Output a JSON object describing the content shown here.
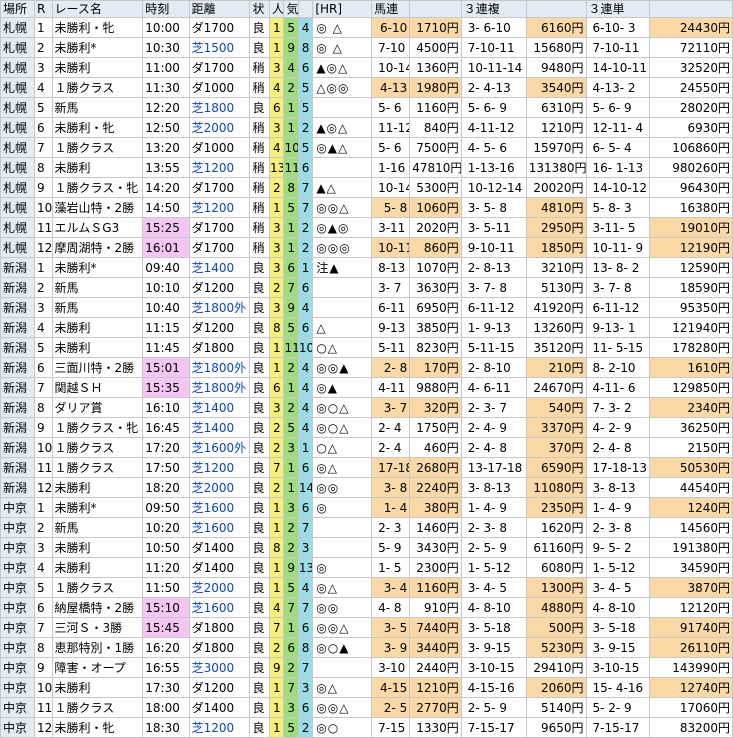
{
  "columns": [
    "場所",
    "R",
    "レース名",
    "時刻",
    "距離",
    "状",
    "人",
    "気",
    "",
    "[HR]",
    "馬連",
    "",
    "３連複",
    "",
    "３連単",
    ""
  ],
  "races": [
    {
      "venue": "札幌",
      "r": "1",
      "name": "未勝利・牝",
      "time": "10:00",
      "dist": "ダ1700",
      "cond": "良",
      "p": [
        "1",
        "5",
        "4"
      ],
      "hr": "◎  △",
      "uma_c": "6-10",
      "uma_p": "1710円",
      "fuku_c": "3- 6-10",
      "fuku_p": "6160円",
      "tan_c": "6-10- 3",
      "tan_p": "24430円",
      "hit": [
        1,
        1,
        1
      ],
      "time_hl": false
    },
    {
      "venue": "札幌",
      "r": "2",
      "name": "未勝利*",
      "time": "10:30",
      "dist": "芝1500",
      "cond": "良",
      "p": [
        "1",
        "9",
        "8"
      ],
      "hr": "◎  △",
      "uma_c": "7-10",
      "uma_p": "4500円",
      "fuku_c": "7-10-11",
      "fuku_p": "15680円",
      "tan_c": "7-10-11",
      "tan_p": "72110円",
      "hit": [
        0,
        0,
        0
      ],
      "time_hl": false
    },
    {
      "venue": "札幌",
      "r": "3",
      "name": "未勝利",
      "time": "11:00",
      "dist": "ダ1700",
      "cond": "稍",
      "p": [
        "3",
        "4",
        "6"
      ],
      "hr": "▲◎△",
      "uma_c": "10-14",
      "uma_p": "1360円",
      "fuku_c": "10-11-14",
      "fuku_p": "9480円",
      "tan_c": "14-10-11",
      "tan_p": "32520円",
      "hit": [
        0,
        0,
        0
      ],
      "time_hl": false
    },
    {
      "venue": "札幌",
      "r": "4",
      "name": "１勝クラス",
      "time": "11:30",
      "dist": "ダ1000",
      "cond": "稍",
      "p": [
        "4",
        "2",
        "5"
      ],
      "hr": "△◎◎",
      "uma_c": "4-13",
      "uma_p": "1980円",
      "fuku_c": "2- 4-13",
      "fuku_p": "3540円",
      "tan_c": "4-13- 2",
      "tan_p": "24550円",
      "hit": [
        1,
        1,
        0
      ],
      "time_hl": false
    },
    {
      "venue": "札幌",
      "r": "5",
      "name": "新馬",
      "time": "12:20",
      "dist": "芝1800",
      "cond": "良",
      "p": [
        "6",
        "1",
        "5"
      ],
      "hr": "",
      "uma_c": "5- 6",
      "uma_p": "1160円",
      "fuku_c": "5- 6- 9",
      "fuku_p": "6310円",
      "tan_c": "5- 6- 9",
      "tan_p": "28020円",
      "hit": [
        0,
        0,
        0
      ],
      "time_hl": false
    },
    {
      "venue": "札幌",
      "r": "6",
      "name": "未勝利・牝",
      "time": "12:50",
      "dist": "芝2000",
      "cond": "稍",
      "p": [
        "3",
        "1",
        "2"
      ],
      "hr": "▲◎△",
      "uma_c": "11-12",
      "uma_p": "840円",
      "fuku_c": "4-11-12",
      "fuku_p": "1210円",
      "tan_c": "12-11- 4",
      "tan_p": "6930円",
      "hit": [
        0,
        0,
        0
      ],
      "time_hl": false
    },
    {
      "venue": "札幌",
      "r": "7",
      "name": "１勝クラス",
      "time": "13:20",
      "dist": "ダ1000",
      "cond": "稍",
      "p": [
        "4",
        "10",
        "5"
      ],
      "hr": "◎▲△",
      "uma_c": "5- 6",
      "uma_p": "7500円",
      "fuku_c": "4- 5- 6",
      "fuku_p": "15970円",
      "tan_c": "6- 5- 4",
      "tan_p": "106860円",
      "hit": [
        0,
        0,
        0
      ],
      "time_hl": false
    },
    {
      "venue": "札幌",
      "r": "8",
      "name": "未勝利",
      "time": "13:55",
      "dist": "芝1200",
      "cond": "稍",
      "p": [
        "13",
        "11",
        "6"
      ],
      "hr": "",
      "uma_c": "1-16",
      "uma_p": "47810円",
      "fuku_c": "1-13-16",
      "fuku_p": "131380円",
      "tan_c": "16- 1-13",
      "tan_p": "980260円",
      "hit": [
        0,
        0,
        0
      ],
      "time_hl": false
    },
    {
      "venue": "札幌",
      "r": "9",
      "name": "１勝クラス・牝",
      "time": "14:20",
      "dist": "ダ1700",
      "cond": "稍",
      "p": [
        "2",
        "8",
        "7"
      ],
      "hr": "▲△",
      "uma_c": "10-14",
      "uma_p": "5300円",
      "fuku_c": "10-12-14",
      "fuku_p": "20020円",
      "tan_c": "14-10-12",
      "tan_p": "96430円",
      "hit": [
        0,
        0,
        0
      ],
      "time_hl": false
    },
    {
      "venue": "札幌",
      "r": "10",
      "name": "藻岩山特・2勝",
      "time": "14:50",
      "dist": "芝1200",
      "cond": "稍",
      "p": [
        "1",
        "5",
        "7"
      ],
      "hr": "◎◎△",
      "uma_c": "5- 8",
      "uma_p": "1060円",
      "fuku_c": "3- 5- 8",
      "fuku_p": "4810円",
      "tan_c": "5- 8- 3",
      "tan_p": "16380円",
      "hit": [
        1,
        1,
        0
      ],
      "time_hl": false
    },
    {
      "venue": "札幌",
      "r": "11",
      "name": "エルムＳG3",
      "time": "15:25",
      "dist": "ダ1700",
      "cond": "稍",
      "p": [
        "3",
        "1",
        "2"
      ],
      "hr": "◎▲◎",
      "uma_c": "3-11",
      "uma_p": "2020円",
      "fuku_c": "3- 5-11",
      "fuku_p": "2950円",
      "tan_c": "3-11- 5",
      "tan_p": "19010円",
      "hit": [
        0,
        1,
        1
      ],
      "time_hl": true
    },
    {
      "venue": "札幌",
      "r": "12",
      "name": "摩周湖特・2勝",
      "time": "16:01",
      "dist": "ダ1700",
      "cond": "稍",
      "p": [
        "3",
        "1",
        "2"
      ],
      "hr": "◎◎◎",
      "uma_c": "10-11",
      "uma_p": "860円",
      "fuku_c": "9-10-11",
      "fuku_p": "1850円",
      "tan_c": "10-11- 9",
      "tan_p": "12190円",
      "hit": [
        1,
        1,
        1
      ],
      "time_hl": true
    },
    {
      "venue": "新潟",
      "r": "1",
      "name": "未勝利*",
      "time": "09:40",
      "dist": "芝1400",
      "cond": "良",
      "p": [
        "3",
        "6",
        "1"
      ],
      "hr": "注▲",
      "uma_c": "8-13",
      "uma_p": "1070円",
      "fuku_c": "2- 8-13",
      "fuku_p": "3210円",
      "tan_c": "13- 8- 2",
      "tan_p": "12590円",
      "hit": [
        0,
        0,
        0
      ],
      "time_hl": false
    },
    {
      "venue": "新潟",
      "r": "2",
      "name": "新馬",
      "time": "10:10",
      "dist": "ダ1200",
      "cond": "良",
      "p": [
        "2",
        "7",
        "6"
      ],
      "hr": "",
      "uma_c": "3- 7",
      "uma_p": "3630円",
      "fuku_c": "3- 7- 8",
      "fuku_p": "5130円",
      "tan_c": "3- 7- 8",
      "tan_p": "18590円",
      "hit": [
        0,
        0,
        0
      ],
      "time_hl": false
    },
    {
      "venue": "新潟",
      "r": "3",
      "name": "新馬",
      "time": "10:40",
      "dist": "芝1800外",
      "cond": "良",
      "p": [
        "3",
        "9",
        "4"
      ],
      "hr": "",
      "uma_c": "6-11",
      "uma_p": "6950円",
      "fuku_c": "6-11-12",
      "fuku_p": "41920円",
      "tan_c": "6-11-12",
      "tan_p": "95350円",
      "hit": [
        0,
        0,
        0
      ],
      "time_hl": false
    },
    {
      "venue": "新潟",
      "r": "4",
      "name": "未勝利",
      "time": "11:15",
      "dist": "ダ1200",
      "cond": "良",
      "p": [
        "8",
        "5",
        "6"
      ],
      "hr": "△",
      "uma_c": "9-13",
      "uma_p": "3850円",
      "fuku_c": "1- 9-13",
      "fuku_p": "13260円",
      "tan_c": "9-13- 1",
      "tan_p": "121940円",
      "hit": [
        0,
        0,
        0
      ],
      "time_hl": false
    },
    {
      "venue": "新潟",
      "r": "5",
      "name": "未勝利",
      "time": "11:45",
      "dist": "ダ1800",
      "cond": "良",
      "p": [
        "1",
        "11",
        "10"
      ],
      "hr": "○△",
      "uma_c": "5-11",
      "uma_p": "8230円",
      "fuku_c": "5-11-15",
      "fuku_p": "35120円",
      "tan_c": "11- 5-15",
      "tan_p": "178280円",
      "hit": [
        0,
        0,
        0
      ],
      "time_hl": false
    },
    {
      "venue": "新潟",
      "r": "6",
      "name": "三面川特・2勝",
      "time": "15:01",
      "dist": "芝1800外",
      "cond": "良",
      "p": [
        "1",
        "2",
        "4"
      ],
      "hr": "◎◎▲",
      "uma_c": "2- 8",
      "uma_p": "170円",
      "fuku_c": "2- 8-10",
      "fuku_p": "210円",
      "tan_c": "8- 2-10",
      "tan_p": "1610円",
      "hit": [
        1,
        1,
        1
      ],
      "time_hl": true
    },
    {
      "venue": "新潟",
      "r": "7",
      "name": "関越ＳＨ",
      "time": "15:35",
      "dist": "芝1800外",
      "cond": "良",
      "p": [
        "6",
        "1",
        "4"
      ],
      "hr": "◎▲",
      "uma_c": "4-11",
      "uma_p": "9880円",
      "fuku_c": "4- 6-11",
      "fuku_p": "24670円",
      "tan_c": "4-11- 6",
      "tan_p": "129850円",
      "hit": [
        0,
        0,
        0
      ],
      "time_hl": true
    },
    {
      "venue": "新潟",
      "r": "8",
      "name": "ダリア賞",
      "time": "16:10",
      "dist": "芝1400",
      "cond": "良",
      "p": [
        "3",
        "2",
        "4"
      ],
      "hr": "◎○△",
      "uma_c": "3- 7",
      "uma_p": "320円",
      "fuku_c": "2- 3- 7",
      "fuku_p": "540円",
      "tan_c": "7- 3- 2",
      "tan_p": "2340円",
      "hit": [
        1,
        1,
        1
      ],
      "time_hl": false
    },
    {
      "venue": "新潟",
      "r": "9",
      "name": "１勝クラス・牝",
      "time": "16:45",
      "dist": "芝1400",
      "cond": "良",
      "p": [
        "2",
        "5",
        "4"
      ],
      "hr": "◎○△",
      "uma_c": "2- 4",
      "uma_p": "1750円",
      "fuku_c": "2- 4- 9",
      "fuku_p": "3370円",
      "tan_c": "4- 2- 9",
      "tan_p": "36250円",
      "hit": [
        0,
        1,
        0
      ],
      "time_hl": false
    },
    {
      "venue": "新潟",
      "r": "10",
      "name": "１勝クラス",
      "time": "17:20",
      "dist": "芝1600外",
      "cond": "良",
      "p": [
        "2",
        "3",
        "1"
      ],
      "hr": "○△",
      "uma_c": "2- 4",
      "uma_p": "460円",
      "fuku_c": "2- 4- 8",
      "fuku_p": "370円",
      "tan_c": "2- 4- 8",
      "tan_p": "2150円",
      "hit": [
        0,
        1,
        0
      ],
      "time_hl": false
    },
    {
      "venue": "新潟",
      "r": "11",
      "name": "１勝クラス",
      "time": "17:50",
      "dist": "芝1200",
      "cond": "良",
      "p": [
        "7",
        "1",
        "6"
      ],
      "hr": "◎△",
      "uma_c": "17-18",
      "uma_p": "2680円",
      "fuku_c": "13-17-18",
      "fuku_p": "6590円",
      "tan_c": "17-18-13",
      "tan_p": "50530円",
      "hit": [
        1,
        1,
        1
      ],
      "time_hl": false
    },
    {
      "venue": "新潟",
      "r": "12",
      "name": "未勝利",
      "time": "18:20",
      "dist": "芝2000",
      "cond": "良",
      "p": [
        "2",
        "1",
        "14"
      ],
      "hr": "◎◎",
      "uma_c": "3- 8",
      "uma_p": "2240円",
      "fuku_c": "3- 8-13",
      "fuku_p": "11080円",
      "tan_c": "3- 8-13",
      "tan_p": "44540円",
      "hit": [
        1,
        1,
        0
      ],
      "time_hl": false
    },
    {
      "venue": "中京",
      "r": "1",
      "name": "未勝利*",
      "time": "09:50",
      "dist": "芝1600",
      "cond": "良",
      "p": [
        "1",
        "3",
        "6"
      ],
      "hr": "◎",
      "uma_c": "1- 4",
      "uma_p": "380円",
      "fuku_c": "1- 4- 9",
      "fuku_p": "2350円",
      "tan_c": "1- 4- 9",
      "tan_p": "1240円",
      "hit": [
        1,
        1,
        1
      ],
      "time_hl": false
    },
    {
      "venue": "中京",
      "r": "2",
      "name": "新馬",
      "time": "10:20",
      "dist": "芝1600",
      "cond": "良",
      "p": [
        "1",
        "2",
        "7"
      ],
      "hr": "",
      "uma_c": "2- 3",
      "uma_p": "1460円",
      "fuku_c": "2- 3- 8",
      "fuku_p": "1620円",
      "tan_c": "2- 3- 8",
      "tan_p": "14560円",
      "hit": [
        0,
        0,
        0
      ],
      "time_hl": false
    },
    {
      "venue": "中京",
      "r": "3",
      "name": "未勝利",
      "time": "10:50",
      "dist": "ダ1400",
      "cond": "良",
      "p": [
        "8",
        "2",
        "3"
      ],
      "hr": "",
      "uma_c": "5- 9",
      "uma_p": "3430円",
      "fuku_c": "2- 5- 9",
      "fuku_p": "61160円",
      "tan_c": "9- 5- 2",
      "tan_p": "191380円",
      "hit": [
        0,
        0,
        0
      ],
      "time_hl": false
    },
    {
      "venue": "中京",
      "r": "4",
      "name": "未勝利",
      "time": "11:20",
      "dist": "ダ1400",
      "cond": "良",
      "p": [
        "1",
        "9",
        "13"
      ],
      "hr": "◎",
      "uma_c": "1- 5",
      "uma_p": "2300円",
      "fuku_c": "1- 5-12",
      "fuku_p": "6080円",
      "tan_c": "1- 5-12",
      "tan_p": "34590円",
      "hit": [
        0,
        0,
        0
      ],
      "time_hl": false
    },
    {
      "venue": "中京",
      "r": "5",
      "name": "１勝クラス",
      "time": "11:50",
      "dist": "芝2000",
      "cond": "良",
      "p": [
        "1",
        "5",
        "4"
      ],
      "hr": "◎△",
      "uma_c": "3- 4",
      "uma_p": "1160円",
      "fuku_c": "3- 4- 5",
      "fuku_p": "1300円",
      "tan_c": "3- 4- 5",
      "tan_p": "3870円",
      "hit": [
        1,
        1,
        1
      ],
      "time_hl": false
    },
    {
      "venue": "中京",
      "r": "6",
      "name": "納屋橋特・2勝",
      "time": "15:10",
      "dist": "芝1600",
      "cond": "良",
      "p": [
        "4",
        "7",
        "7"
      ],
      "hr": "◎◎",
      "uma_c": "4- 8",
      "uma_p": "910円",
      "fuku_c": "4- 8-10",
      "fuku_p": "4880円",
      "tan_c": "4- 8-10",
      "tan_p": "12120円",
      "hit": [
        0,
        1,
        0
      ],
      "time_hl": true
    },
    {
      "venue": "中京",
      "r": "7",
      "name": "三河Ｓ・3勝",
      "time": "15:45",
      "dist": "ダ1800",
      "cond": "良",
      "p": [
        "7",
        "1",
        "6"
      ],
      "hr": "◎◎△",
      "uma_c": "3- 5",
      "uma_p": "7440円",
      "fuku_c": "3- 5-18",
      "fuku_p": "500円",
      "tan_c": "3- 5-18",
      "tan_p": "91740円",
      "hit": [
        1,
        1,
        1
      ],
      "time_hl": true
    },
    {
      "venue": "中京",
      "r": "8",
      "name": "恵那特別・1勝",
      "time": "16:20",
      "dist": "ダ1800",
      "cond": "良",
      "p": [
        "2",
        "6",
        "8"
      ],
      "hr": "◎○▲",
      "uma_c": "3- 9",
      "uma_p": "3440円",
      "fuku_c": "3- 9-15",
      "fuku_p": "5230円",
      "tan_c": "3- 9-15",
      "tan_p": "26110円",
      "hit": [
        1,
        1,
        1
      ],
      "time_hl": false
    },
    {
      "venue": "中京",
      "r": "9",
      "name": "障害・オープ",
      "time": "16:55",
      "dist": "芝3000",
      "cond": "良",
      "p": [
        "9",
        "2",
        "7"
      ],
      "hr": "",
      "uma_c": "3-10",
      "uma_p": "2440円",
      "fuku_c": "3-10-15",
      "fuku_p": "29410円",
      "tan_c": "3-10-15",
      "tan_p": "143990円",
      "hit": [
        0,
        0,
        0
      ],
      "time_hl": false
    },
    {
      "venue": "中京",
      "r": "10",
      "name": "未勝利",
      "time": "17:30",
      "dist": "ダ1200",
      "cond": "良",
      "p": [
        "1",
        "7",
        "3"
      ],
      "hr": "◎△",
      "uma_c": "4-15",
      "uma_p": "1210円",
      "fuku_c": "4-15-16",
      "fuku_p": "2060円",
      "tan_c": "15- 4-16",
      "tan_p": "12740円",
      "hit": [
        1,
        1,
        1
      ],
      "time_hl": false
    },
    {
      "venue": "中京",
      "r": "11",
      "name": "１勝クラス",
      "time": "18:00",
      "dist": "ダ1400",
      "cond": "良",
      "p": [
        "1",
        "3",
        "6"
      ],
      "hr": "◎◎△",
      "uma_c": "2- 5",
      "uma_p": "2770円",
      "fuku_c": "2- 5- 9",
      "fuku_p": "5140円",
      "tan_c": "5- 2- 9",
      "tan_p": "17060円",
      "hit": [
        1,
        0,
        0
      ],
      "time_hl": false
    },
    {
      "venue": "中京",
      "r": "12",
      "name": "未勝利・牝",
      "time": "18:30",
      "dist": "芝1200",
      "cond": "良",
      "p": [
        "1",
        "5",
        "2"
      ],
      "hr": "◎○",
      "uma_c": "7-15",
      "uma_p": "1330円",
      "fuku_c": "7-15-17",
      "fuku_p": "9650円",
      "tan_c": "7-15-17",
      "tan_p": "83200円",
      "hit": [
        0,
        0,
        0
      ],
      "time_hl": false
    }
  ]
}
